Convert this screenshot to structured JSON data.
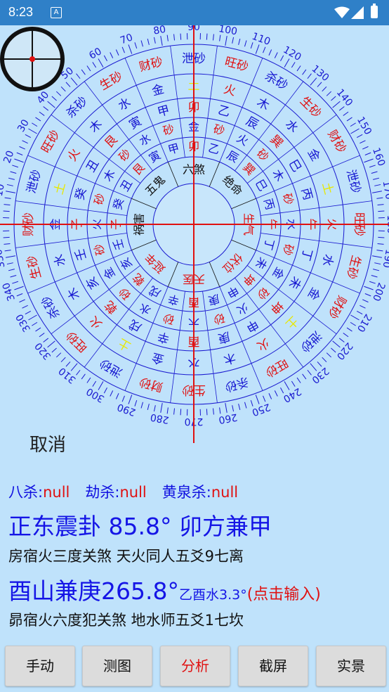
{
  "status": {
    "time": "8:23",
    "app_icon": "A"
  },
  "compass": {
    "degree_labels": [
      "0",
      "10",
      "20",
      "30",
      "40",
      "50",
      "60",
      "70",
      "80",
      "90",
      "100",
      "110",
      "120",
      "130",
      "140",
      "150",
      "160",
      "170",
      "180",
      "190",
      "200",
      "210",
      "220",
      "230",
      "240",
      "250",
      "260",
      "270",
      "280",
      "290",
      "300",
      "310",
      "320",
      "330",
      "340",
      "350"
    ],
    "rings": {
      "ring1": [
        "旺砂",
        "泄砂",
        "财砂",
        "生砂",
        "杀砂",
        "旺砂",
        "泄砂",
        "财砂",
        "生砂",
        "杀砂",
        "旺砂",
        "泄砂",
        "财砂",
        "生砂",
        "杀砂",
        "旺砂",
        "泄砂",
        "财砂",
        "生砂",
        "杀砂",
        "旺砂",
        "泄砂",
        "财砂",
        "生砂"
      ],
      "ring2": [
        "火",
        "土",
        "金",
        "水",
        "木",
        "火",
        "土",
        "金",
        "水",
        "木",
        "火",
        "土",
        "金",
        "水",
        "木",
        "火",
        "土",
        "金",
        "水",
        "木",
        "火",
        "土",
        "金",
        "水"
      ],
      "ring3": [
        "午",
        "丙",
        "巳",
        "巽",
        "辰",
        "乙",
        "卯",
        "甲",
        "寅",
        "艮",
        "丑",
        "癸",
        "子",
        "壬",
        "亥",
        "乾",
        "戌",
        "辛",
        "酉",
        "庚",
        "申",
        "坤",
        "未",
        "丁"
      ],
      "ring4": [
        "水",
        "砂",
        "木",
        "砂",
        "火",
        "砂",
        "金",
        "砂",
        "水",
        "砂",
        "木",
        "砂",
        "火",
        "砂",
        "金",
        "砂",
        "水",
        "砂",
        "木",
        "砂",
        "火",
        "砂",
        "金",
        "砂"
      ],
      "ring5": [
        "午",
        "丙",
        "巳",
        "巽",
        "辰",
        "乙",
        "卯",
        "甲",
        "寅",
        "艮",
        "丑",
        "癸",
        "子",
        "壬",
        "亥",
        "乾",
        "戌",
        "辛",
        "酉",
        "庚",
        "申",
        "坤",
        "未",
        "丁"
      ]
    },
    "inner_labels": [
      "绝命",
      "六煞",
      "五鬼",
      "祸害",
      "延年",
      "天医",
      "伏位",
      "生气"
    ]
  },
  "controls": {
    "cancel": "取消"
  },
  "sha": {
    "bazha_label": "八杀:",
    "bazha_value": "null",
    "jiesha_label": "劫杀:",
    "jiesha_value": "null",
    "huangquan_label": "黄泉杀:",
    "huangquan_value": "null"
  },
  "reading1": {
    "main": "正东震卦 85.8°    卯方兼甲",
    "desc": "房宿火三度关煞    天火同人五爻9七离"
  },
  "reading2": {
    "main": "酉山兼庚265.8°",
    "small": "乙酉水3.3°",
    "hint": "(点击输入)",
    "desc": "昴宿火六度犯关煞    地水师五爻1七坎"
  },
  "buttons": [
    "手动",
    "测图",
    "分析",
    "截屏",
    "实景"
  ]
}
